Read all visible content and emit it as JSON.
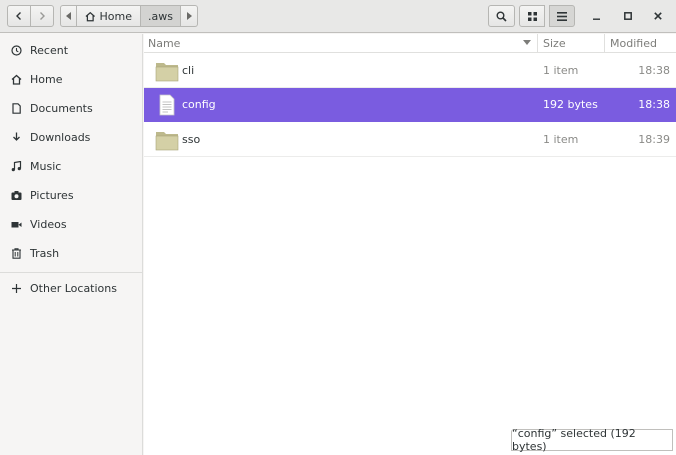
{
  "header": {
    "path": [
      {
        "label": "Home",
        "icon": "home-icon"
      },
      {
        "label": ".aws"
      }
    ]
  },
  "sidebar": {
    "items": [
      {
        "label": "Recent",
        "icon": "clock-icon"
      },
      {
        "label": "Home",
        "icon": "home-icon"
      },
      {
        "label": "Documents",
        "icon": "document-icon"
      },
      {
        "label": "Downloads",
        "icon": "download-icon"
      },
      {
        "label": "Music",
        "icon": "music-icon"
      },
      {
        "label": "Pictures",
        "icon": "camera-icon"
      },
      {
        "label": "Videos",
        "icon": "video-icon"
      },
      {
        "label": "Trash",
        "icon": "trash-icon"
      }
    ],
    "other_locations": {
      "label": "Other Locations",
      "icon": "plus-icon"
    }
  },
  "columns": {
    "name": "Name",
    "size": "Size",
    "modified": "Modified"
  },
  "files": [
    {
      "name": "cli",
      "type": "folder",
      "size": "1 item",
      "modified": "18:38",
      "selected": false
    },
    {
      "name": "config",
      "type": "text-file",
      "size": "192 bytes",
      "modified": "18:38",
      "selected": true
    },
    {
      "name": "sso",
      "type": "folder",
      "size": "1 item",
      "modified": "18:39",
      "selected": false
    }
  ],
  "status": "“config” selected  (192 bytes)",
  "colors": {
    "selection": "#7a5ce0",
    "folder": "#cfcba0"
  }
}
